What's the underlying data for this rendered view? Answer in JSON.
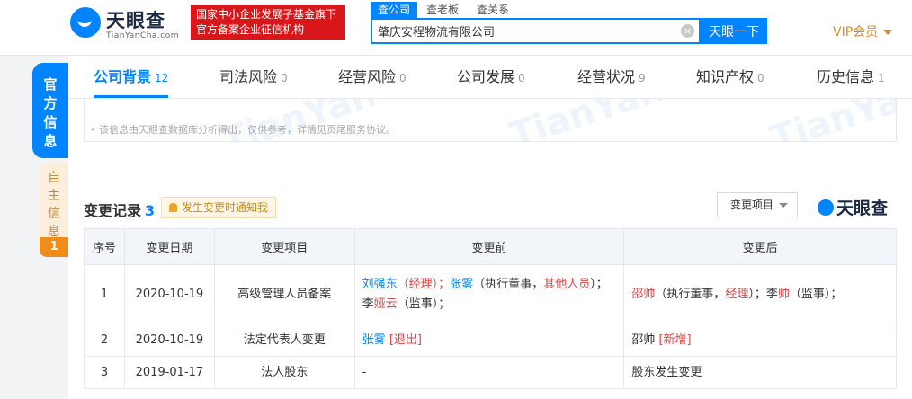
{
  "header": {
    "logo_cn": "天眼查",
    "logo_en": "TianYanCha.com",
    "gov_badge": [
      "国家中小企业发展子基金旗下",
      "官方备案企业征信机构"
    ],
    "search_tabs": [
      "查公司",
      "查老板",
      "查关系"
    ],
    "search_value": "肇庆安程物流有限公司",
    "search_button": "天眼一下",
    "vip": "VIP会员"
  },
  "side_tabs": {
    "official": "官方信息",
    "self": "自主信息",
    "self_count": "1"
  },
  "tabs": [
    {
      "label": "公司背景",
      "count": "12"
    },
    {
      "label": "司法风险",
      "count": "0"
    },
    {
      "label": "经营风险",
      "count": "0"
    },
    {
      "label": "公司发展",
      "count": "0"
    },
    {
      "label": "经营状况",
      "count": "9"
    },
    {
      "label": "知识产权",
      "count": "0"
    },
    {
      "label": "历史信息",
      "count": "1"
    }
  ],
  "notice": "• 该信息由天眼查数据库分析得出，仅供参考，详情见页尾服务协议。",
  "section": {
    "title": "变更记录",
    "count": "3",
    "notify_label": "发生变更时通知我",
    "filter_label": "变更项目",
    "brand": "天眼查"
  },
  "table": {
    "headers": [
      "序号",
      "变更日期",
      "变更项目",
      "变更前",
      "变更后"
    ],
    "rows": [
      {
        "index": "1",
        "date": "2020-10-19",
        "item": "高级管理人员备案",
        "before": {
          "p1_name": "刘强东",
          "p1_role": "（经理）",
          "sep1": "；",
          "p2_name": "张雾",
          "p2_paren_open": "（执行董事，",
          "p2_role_red": "其他人员",
          "p2_paren_close": "）；",
          "p3_name_plain": "李",
          "p3_name_red": "娅云",
          "p3_role": "（监事）；"
        },
        "after": {
          "p1_name": "邵帅",
          "p1_open": "（执行董事，",
          "p1_role_red": "经理",
          "p1_close": "）；",
          "p2_name_plain": "李",
          "p2_name_red": "帅",
          "p2_role": "（监事）；"
        }
      },
      {
        "index": "2",
        "date": "2020-10-19",
        "item": "法定代表人变更",
        "before": {
          "name": "张雾",
          "tag": "[退出]"
        },
        "after": {
          "name": "邵帅",
          "tag": "[新增]"
        }
      },
      {
        "index": "3",
        "date": "2019-01-17",
        "item": "法人股东",
        "before_text": "-",
        "after_text": "股东发生变更"
      }
    ]
  }
}
